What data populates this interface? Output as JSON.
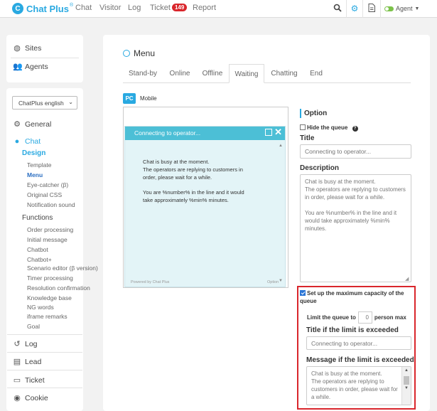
{
  "colors": {
    "accent": "#29a9e1",
    "highlight": "#d9262c",
    "chat_header": "#4cbfd6",
    "chat_body": "#e3f4f7"
  },
  "header": {
    "logo_mark": "C",
    "logo_text": "Chat Plus",
    "logo_sup": "®",
    "nav": [
      "Chat",
      "Visitor",
      "Log",
      "Ticket",
      "Report"
    ],
    "ticket_count": "149",
    "agent": "Agent"
  },
  "sidebar": {
    "top_items": [
      "Sites",
      "Agents"
    ],
    "language": "ChatPlus english",
    "general": "General",
    "chat": "Chat",
    "design": "Design",
    "design_items": [
      "Template",
      "Menu",
      "Eye-catcher (β)",
      "Original CSS",
      "Notification sound"
    ],
    "functions": "Functions",
    "function_items": [
      "Order processing",
      "Initial message",
      "Chatbot",
      "Chatbot+",
      "Scenario editor (β version)",
      "Timer processing",
      "Resolution confirmation",
      "Knowledge base",
      "NG words",
      "iframe remarks",
      "Goal"
    ],
    "bottom_items": [
      "Log",
      "Lead",
      "Ticket",
      "Cookie"
    ]
  },
  "main": {
    "title": "Menu",
    "tabs": [
      "Stand-by",
      "Online",
      "Offline",
      "Waiting",
      "Chatting",
      "End"
    ],
    "device": {
      "pc": "PC",
      "mobile": "Mobile"
    },
    "preview": {
      "header": "Connecting to operator...",
      "msg1": "Chat is busy at the moment.\nThe operators are replying to customers in order, please wait for a while.",
      "msg2": "You are %number% in the line and it would take approximately %min% minutes.",
      "powered": "Powered by Chat Plus",
      "option": "Option"
    },
    "option": {
      "title": "Option",
      "hide_queue": "Hide the queue",
      "title_label": "Title",
      "title_value": "Connecting to operator...",
      "desc_label": "Description",
      "desc_value": "Chat is busy at the moment.\nThe operators are replying to customers in order, please wait for a while.\n\nYou are %number% in the line and it would take approximately %min% minutes.",
      "max_label": "Set up the maximum capacity of the queue",
      "limit_prefix": "Limit the queue to",
      "limit_value": "0",
      "limit_suffix": "person max",
      "exceed_title_label": "Title if the limit is exceeded",
      "exceed_title_value": "Connecting to operator...",
      "exceed_msg_label": "Message if the limit is exceeded",
      "exceed_msg_value": "Chat is busy at the moment.\nThe operators are replying to customers in order, please wait for a while."
    }
  }
}
